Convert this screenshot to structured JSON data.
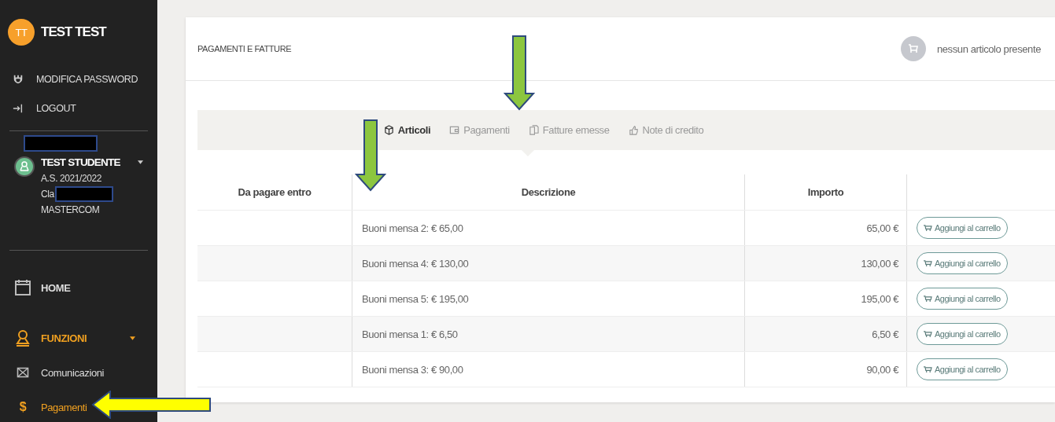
{
  "user": {
    "initials": "TT",
    "name": "TEST TEST"
  },
  "account_menu": [
    {
      "label": "MODIFICA PASSWORD",
      "kind": "password"
    },
    {
      "label": "LOGOUT",
      "kind": "logout"
    }
  ],
  "student": {
    "name": "TEST STUDENTE",
    "year": "A.S. 2021/2022",
    "class_label": "Cla",
    "school": "MASTERCOM"
  },
  "nav": [
    {
      "label": "HOME",
      "kind": "home",
      "selected": false
    },
    {
      "label": "FUNZIONI",
      "kind": "section",
      "selected": true
    },
    {
      "label": "Comunicazioni",
      "kind": "mail",
      "selected": false
    },
    {
      "label": "Pagamenti",
      "kind": "payments",
      "selected": true,
      "glyph": "$"
    }
  ],
  "page_title": "PAGAMENTI E FATTURE",
  "cart": {
    "text": "nessun articolo presente"
  },
  "tabs": [
    {
      "label": "Articoli",
      "kind": "box",
      "selected": true
    },
    {
      "label": "Pagamenti",
      "kind": "wallet",
      "selected": false
    },
    {
      "label": "Fatture emesse",
      "kind": "docs",
      "selected": false
    },
    {
      "label": "Note di credito",
      "kind": "hand",
      "selected": false
    }
  ],
  "table": {
    "columns": [
      "Da pagare entro",
      "Descrizione",
      "Importo"
    ],
    "rows": [
      {
        "description": "Buoni mensa 2: € 65,00",
        "amount": "65,00 €",
        "action": "Aggiungi al carrello"
      },
      {
        "description": "Buoni mensa 4: € 130,00",
        "amount": "130,00 €",
        "action": "Aggiungi al carrello"
      },
      {
        "description": "Buoni mensa 5: € 195,00",
        "amount": "195,00 €",
        "action": "Aggiungi al carrello"
      },
      {
        "description": "Buoni mensa 1: € 6,50",
        "amount": "6,50 €",
        "action": "Aggiungi al carrello"
      },
      {
        "description": "Buoni mensa 3: € 90,00",
        "amount": "90,00 €",
        "action": "Aggiungi al carrello"
      }
    ]
  }
}
